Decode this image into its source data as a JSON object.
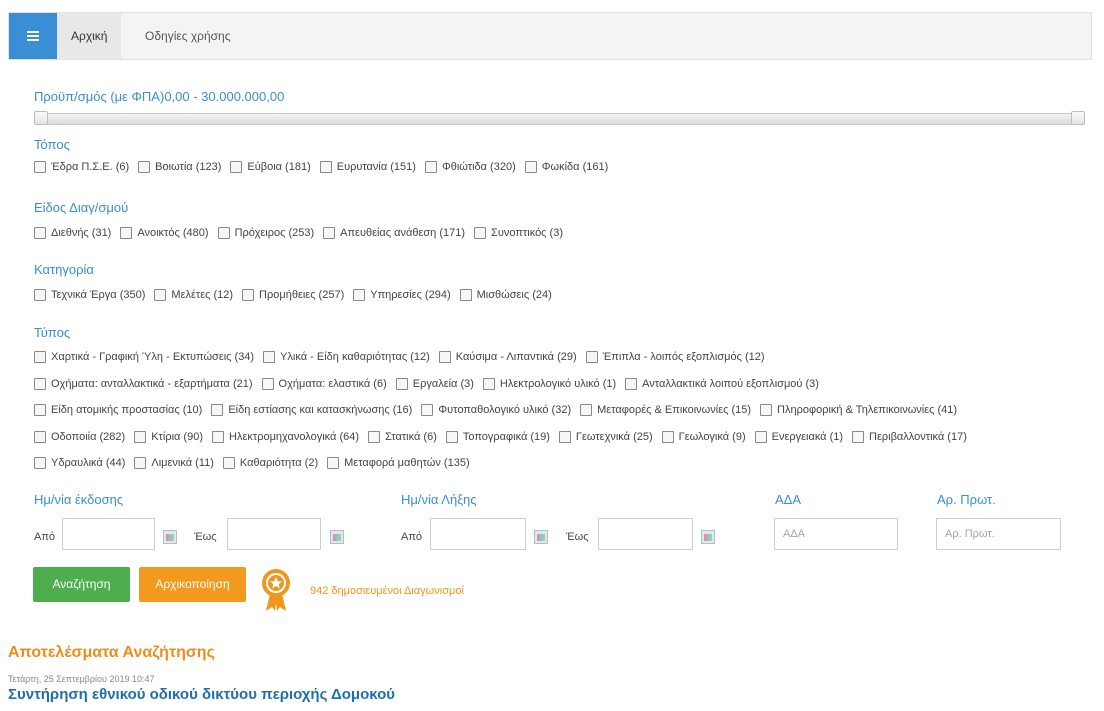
{
  "nav": {
    "tabs": [
      {
        "label": "Αρχική"
      },
      {
        "label": "Οδηγίες χρήσης"
      }
    ]
  },
  "budget": {
    "label": "Προϋπ/σμός (με ΦΠΑ)",
    "range": "0,00 - 30.000.000,00",
    "min_fraction": 0,
    "max_fraction": 1
  },
  "sections": {
    "topos": {
      "title": "Τόπος",
      "items": [
        "Έδρα Π.Σ.Ε. (6)",
        "Βοιωτία (123)",
        "Εύβοια (181)",
        "Ευρυτανία (151)",
        "Φθιώτιδα (320)",
        "Φωκίδα (161)"
      ]
    },
    "eidos": {
      "title": "Είδος Διαγ/σμού",
      "items": [
        "Διεθνής (31)",
        "Ανοικτός (480)",
        "Πρόχειρος (253)",
        "Απευθείας ανάθεση (171)",
        "Συνοπτικός (3)"
      ]
    },
    "kategoria": {
      "title": "Κατηγορία",
      "items": [
        "Τεχνικά Έργα (350)",
        "Μελέτες (12)",
        "Προμήθειες (257)",
        "Υπηρεσίες (294)",
        "Μισθώσεις (24)"
      ]
    },
    "typos": {
      "title": "Τύπος",
      "rows": [
        [
          "Χαρτικά - Γραφική Ύλη - Εκτυπώσεις (34)",
          "Υλικά - Είδη καθαριότητας (12)",
          "Καύσιμα - Λιπαντικά (29)",
          "Έπιπλα - λοιπός εξοπλισμός (12)"
        ],
        [
          "Οχήματα: ανταλλακτικά - εξαρτήματα (21)",
          "Οχήματα: ελαστικά (6)",
          "Εργαλεία (3)",
          "Ηλεκτρολογικό υλικό (1)",
          "Ανταλλακτικά λοιπού εξοπλισμού (3)"
        ],
        [
          "Είδη ατομικής προστασίας (10)",
          "Είδη εστίασης και κατασκήνωσης (16)",
          "Φυτοπαθολογικό υλικό (32)",
          "Μεταφορές & Επικοινωνίες (15)",
          "Πληροφορική & Τηλεπικοινωνίες (41)"
        ],
        [
          "Οδοποιία (282)",
          "Κτίρια (90)",
          "Ηλεκτρομηχανολογικά (64)",
          "Στατικά (6)",
          "Τοπογραφικά (19)",
          "Γεωτεχνικά (25)",
          "Γεωλογικά (9)",
          "Ενεργειακά (1)",
          "Περιβαλλοντικά (17)"
        ],
        [
          "Υδραυλικά (44)",
          "Λιμενικά (11)",
          "Καθαριότητα (2)",
          "Μεταφορά μαθητών (135)"
        ]
      ]
    }
  },
  "filters": {
    "issue_date": {
      "title": "Ημ/νία έκδοσης",
      "from": "Από",
      "to": "Έως"
    },
    "end_date": {
      "title": "Ημ/νία Λήξης",
      "from": "Από",
      "to": "Έως"
    },
    "ada": {
      "title": "ΑΔΑ",
      "placeholder": "ΑΔΑ"
    },
    "protocol": {
      "title": "Αρ. Πρωτ.",
      "placeholder": "Αρ. Πρωτ."
    }
  },
  "actions": {
    "search": "Αναζήτηση",
    "reset": "Αρχικοποίηση",
    "count_text": "942 δημοσιευμένοι Διαγωνισμοί",
    "colors": {
      "search": "#4cae4c",
      "reset": "#f39a1e",
      "accent": "#3a8ed4"
    }
  },
  "results": {
    "title": "Αποτελέσματα Αναζήτησης",
    "items": [
      {
        "date": "Τετάρτη, 25 Σεπτεμβρίου 2019 10:47",
        "title": "Συντήρηση εθνικού οδικού δικτύου περιοχής Δομοκού"
      }
    ]
  },
  "icons": {
    "menu": "hamburger-icon",
    "calendar": "calendar-icon",
    "badge": "medal-icon"
  }
}
